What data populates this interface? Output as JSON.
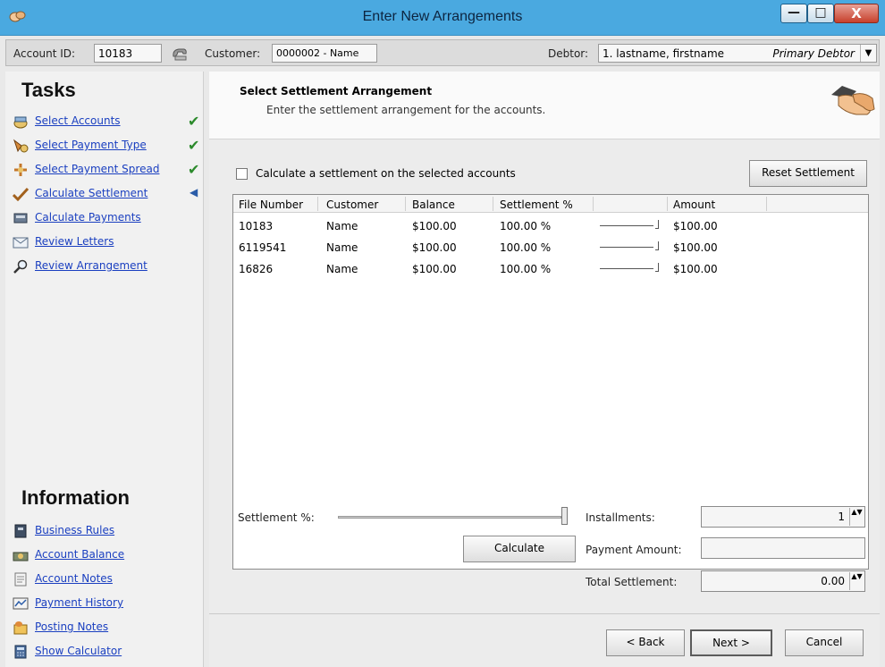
{
  "window": {
    "title": "Enter New Arrangements",
    "minimize": "—",
    "maximize": "□",
    "close": "X"
  },
  "account_bar": {
    "account_id_label": "Account ID:",
    "account_id_value": "10183",
    "customer_label": "Customer:",
    "customer_value": "0000002 - Name",
    "debtor_label": "Debtor:",
    "debtor_value": "1. lastname, firstname",
    "debtor_type": "Primary Debtor",
    "dropdown_arrow": "▼"
  },
  "tasks": {
    "title": "Tasks",
    "items": [
      {
        "label": "Select Accounts",
        "status": "✔"
      },
      {
        "label": "Select Payment Type",
        "status": "✔"
      },
      {
        "label": "Select Payment Spread",
        "status": "✔"
      },
      {
        "label": "Calculate Settlement",
        "status": "◀"
      },
      {
        "label": "Calculate Payments",
        "status": ""
      },
      {
        "label": "Review Letters",
        "status": ""
      },
      {
        "label": "Review Arrangement",
        "status": ""
      }
    ]
  },
  "information": {
    "title": "Information",
    "items": [
      {
        "label": "Business Rules"
      },
      {
        "label": "Account Balance"
      },
      {
        "label": "Account Notes"
      },
      {
        "label": "Payment History"
      },
      {
        "label": "Posting Notes"
      },
      {
        "label": "Show Calculator"
      }
    ]
  },
  "header": {
    "title": "Select Settlement Arrangement",
    "subtitle": "Enter the settlement arrangement for the accounts."
  },
  "settlement": {
    "checkbox_label": "Calculate a settlement on the selected accounts",
    "reset_button": "Reset Settlement",
    "columns": [
      "File Number",
      "Customer",
      "Balance",
      "Settlement %",
      "",
      "Amount"
    ],
    "rows": [
      {
        "file_number": "10183",
        "customer": "Name",
        "balance": "$100.00",
        "settlement_pct": "100.00 %",
        "amount": "$100.00"
      },
      {
        "file_number": "6119541",
        "customer": "Name",
        "balance": "$100.00",
        "settlement_pct": "100.00 %",
        "amount": "$100.00"
      },
      {
        "file_number": "16826",
        "customer": "Name",
        "balance": "$100.00",
        "settlement_pct": "100.00 %",
        "amount": "$100.00"
      }
    ],
    "settlement_pct_label": "Settlement %:",
    "calculate_button": "Calculate",
    "installments_label": "Installments:",
    "installments_value": "1",
    "payment_amount_label": "Payment Amount:",
    "payment_amount_value": "",
    "total_settlement_label": "Total Settlement:",
    "total_settlement_value": "0.00",
    "spin_arrows": "▲▼"
  },
  "footer": {
    "back": "< Back",
    "next": "Next >",
    "cancel": "Cancel"
  }
}
